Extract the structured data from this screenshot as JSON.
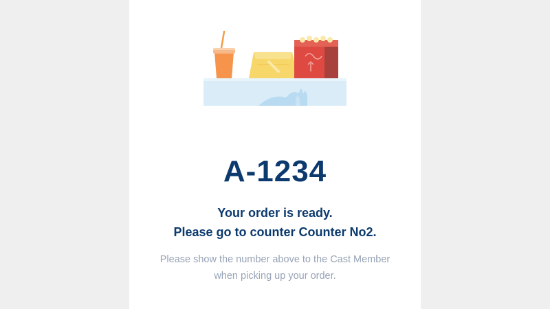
{
  "order": {
    "number": "A-1234",
    "ready_message": "Your order is ready.",
    "counter_message": "Please go to counter Counter No2.",
    "instruction_line1": "Please show the number above to the Cast Member",
    "instruction_line2": "when picking up your order."
  },
  "illustration": {
    "icon": "food-tray-illustration",
    "colors": {
      "tray": "#d9ecf8",
      "drink": "#f5944a",
      "box": "#f7d66a",
      "popcorn": "#de4a41",
      "title": "#0c3a6e",
      "hint": "#97a3b6"
    }
  }
}
